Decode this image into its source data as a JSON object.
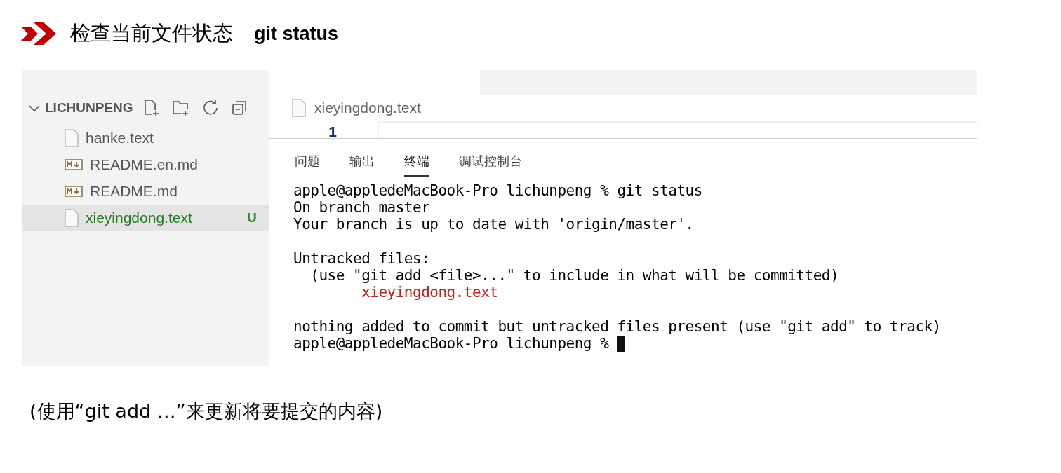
{
  "heading": {
    "title": "检查当前文件状态",
    "command": "git status"
  },
  "explorer": {
    "folder": "LICHUNPENG",
    "expanded": true,
    "files": [
      {
        "name": "hanke.text",
        "kind": "file",
        "selected": false,
        "untracked": false
      },
      {
        "name": "README.en.md",
        "kind": "markdown",
        "selected": false,
        "untracked": false
      },
      {
        "name": "README.md",
        "kind": "markdown",
        "selected": false,
        "untracked": false
      },
      {
        "name": "xieyingdong.text",
        "kind": "file",
        "selected": true,
        "untracked": true,
        "badge": "U"
      }
    ]
  },
  "editor": {
    "tab": "xieyingdong.text",
    "line_number": "1"
  },
  "panel": {
    "tabs": [
      {
        "label": "问题",
        "selected": false
      },
      {
        "label": "输出",
        "selected": false
      },
      {
        "label": "终端",
        "selected": true
      },
      {
        "label": "调试控制台",
        "selected": false
      }
    ],
    "terminal": [
      {
        "kind": "text",
        "text": "apple@appledeMacBook-Pro lichunpeng % git status"
      },
      {
        "kind": "text",
        "text": "On branch master"
      },
      {
        "kind": "text",
        "text": "Your branch is up to date with 'origin/master'."
      },
      {
        "kind": "blank"
      },
      {
        "kind": "text",
        "text": "Untracked files:"
      },
      {
        "kind": "text",
        "text": "  (use \"git add <file>...\" to include in what will be committed)"
      },
      {
        "kind": "untracked",
        "text": "        xieyingdong.text",
        "color": "#c91b1b"
      },
      {
        "kind": "blank"
      },
      {
        "kind": "text",
        "text": "nothing added to commit but untracked files present (use \"git add\" to track)"
      },
      {
        "kind": "prompt",
        "text": "apple@appledeMacBook-Pro lichunpeng % "
      }
    ]
  },
  "note": "(使用“git add …”来更新将要提交的内容)"
}
